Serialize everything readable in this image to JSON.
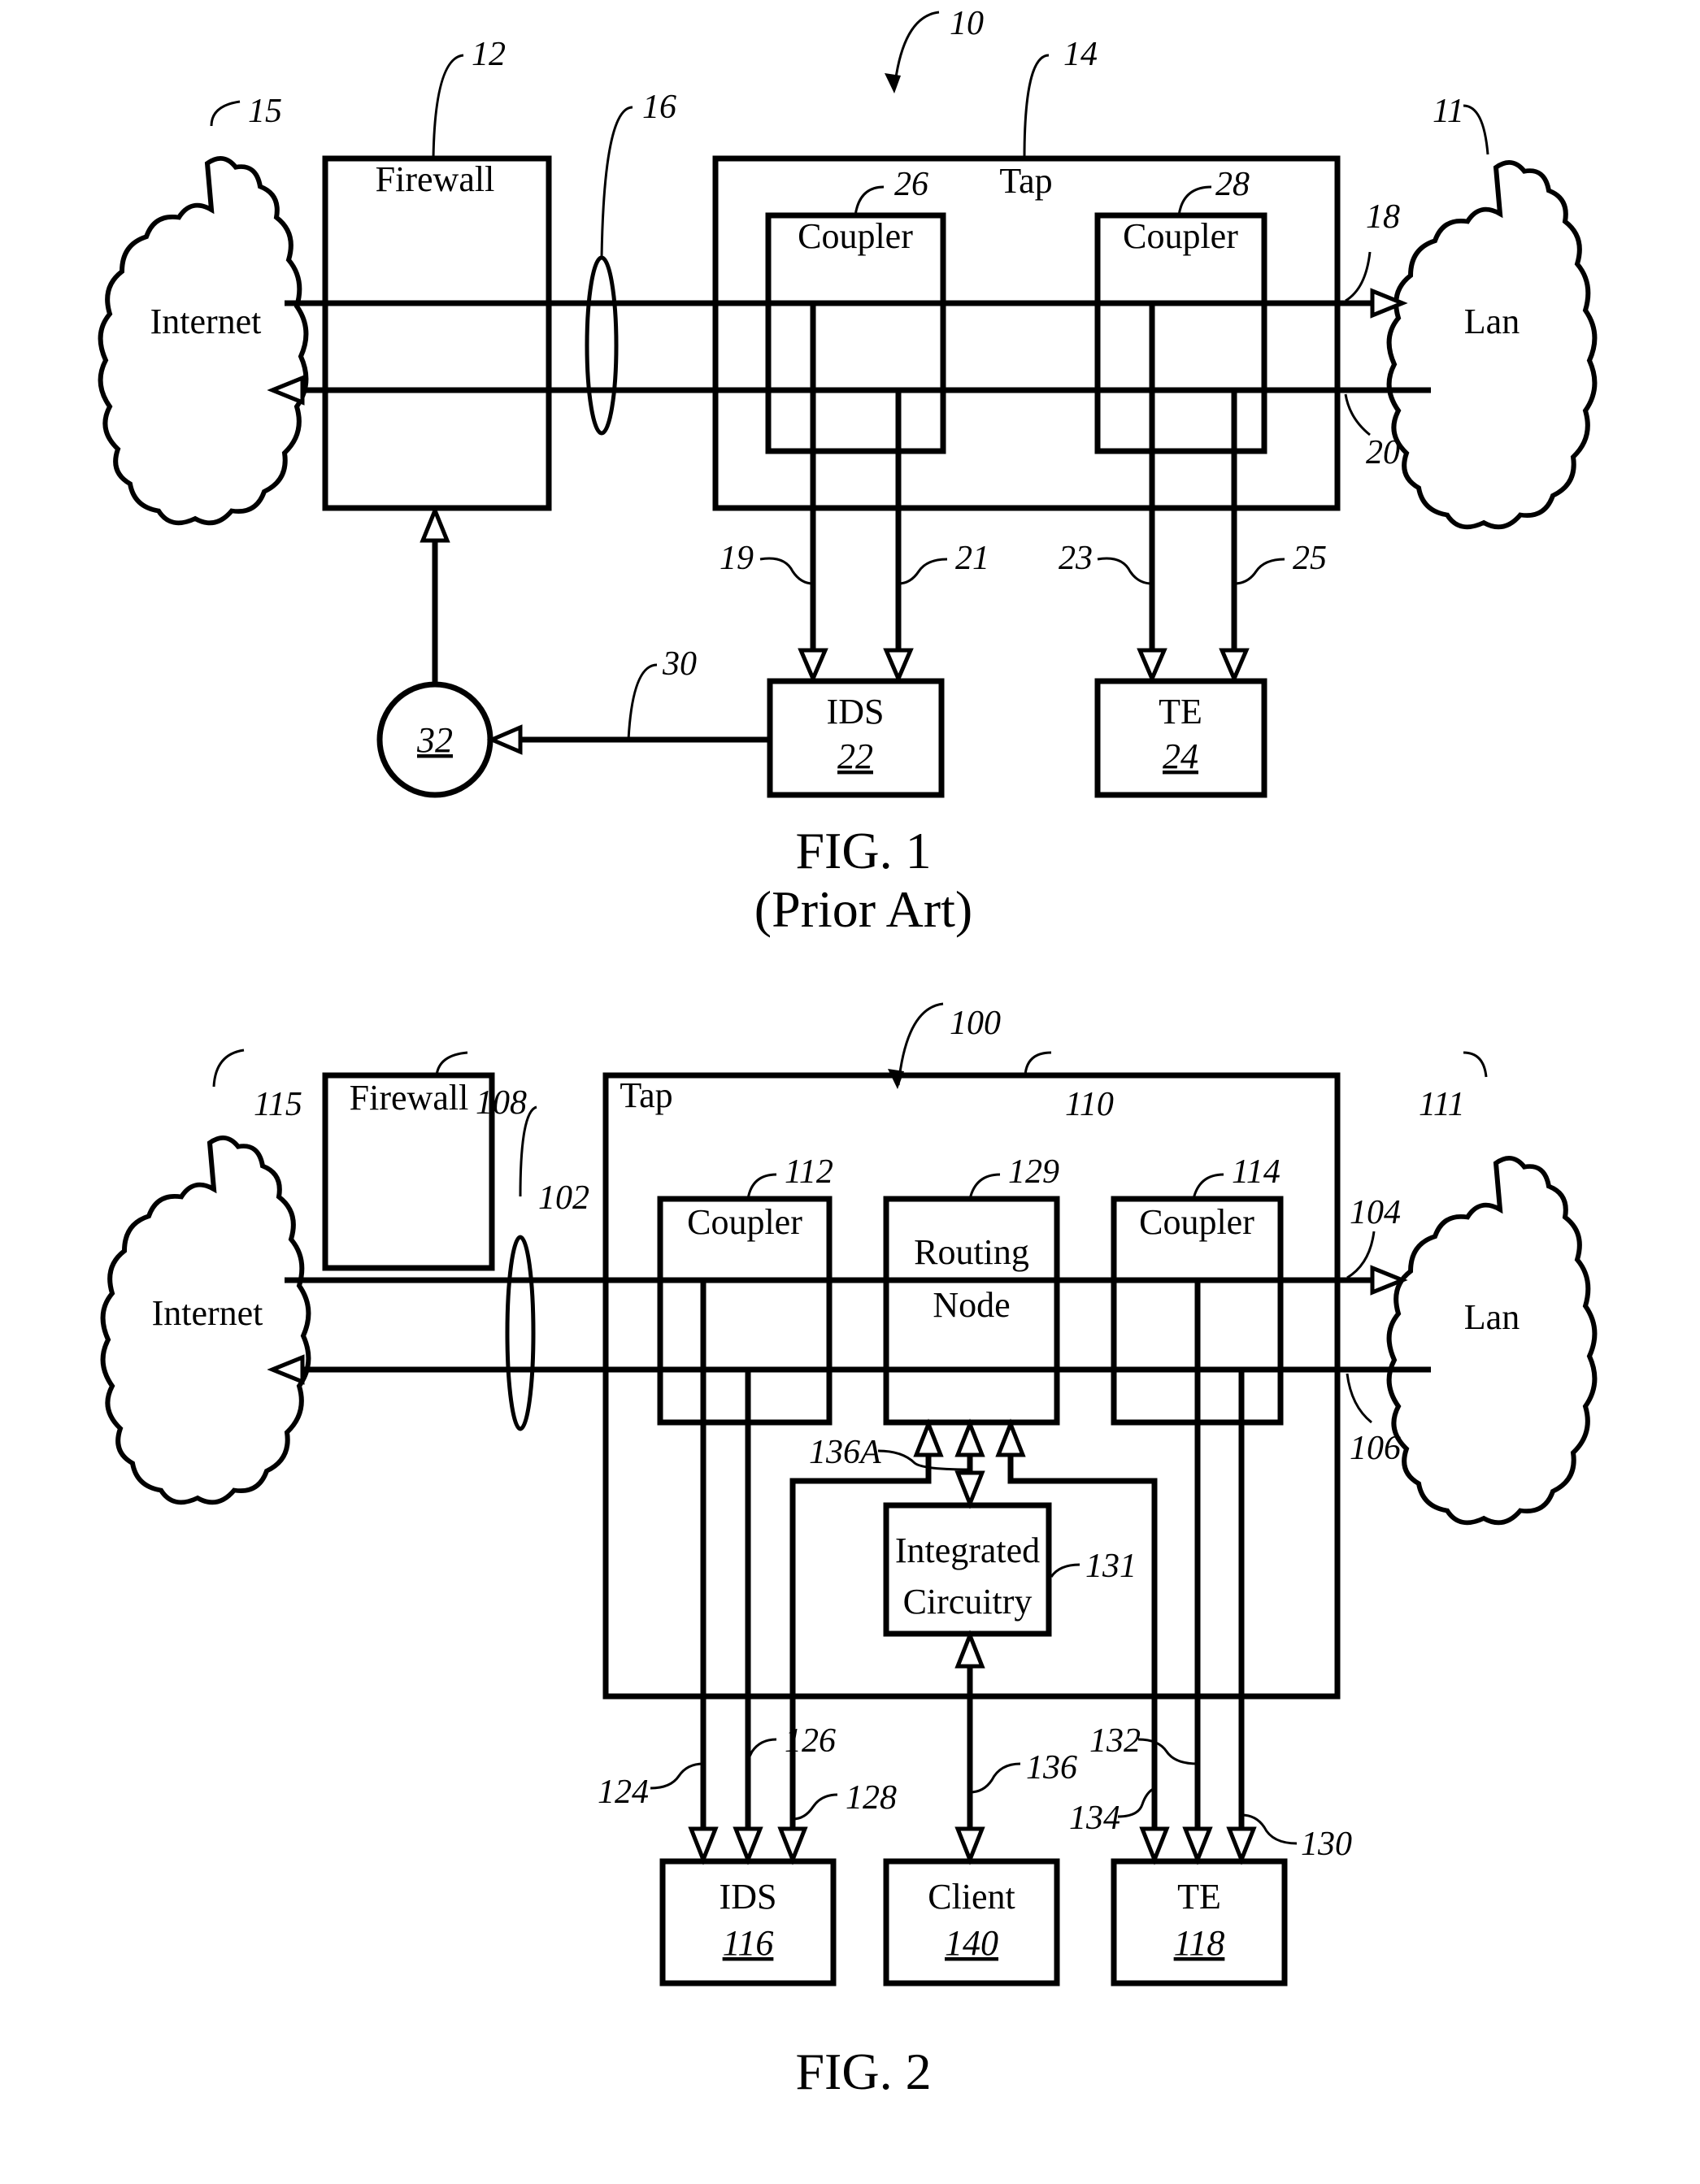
{
  "figures": [
    {
      "id": "fig1",
      "caption": "FIG. 1",
      "subcaption": "(Prior Art)",
      "system_ref": "10",
      "internet": {
        "label": "Internet",
        "ref": "15"
      },
      "lan": {
        "label": "Lan",
        "ref": "11"
      },
      "firewall": {
        "label": "Firewall",
        "ref": "12"
      },
      "link_bundle_ref": "16",
      "tap": {
        "label": "Tap",
        "ref": "14"
      },
      "coupler_left": {
        "label": "Coupler",
        "ref": "26"
      },
      "coupler_right": {
        "label": "Coupler",
        "ref": "28"
      },
      "line_top_ref": "18",
      "line_bottom_ref": "20",
      "ids": {
        "label": "IDS",
        "ref": "22"
      },
      "te": {
        "label": "TE",
        "ref": "24"
      },
      "feeds": [
        "19",
        "21",
        "23",
        "25"
      ],
      "alert_line_ref": "30",
      "controller": {
        "ref": "32"
      }
    },
    {
      "id": "fig2",
      "caption": "FIG. 2",
      "system_ref": "100",
      "internet": {
        "label": "Internet",
        "ref": "115"
      },
      "lan": {
        "label": "Lan",
        "ref": "111"
      },
      "firewall": {
        "label": "Firewall",
        "ref": "108"
      },
      "link_bundle_ref": "102",
      "tap": {
        "label": "Tap",
        "ref": "110"
      },
      "coupler_left": {
        "label": "Coupler",
        "ref": "112"
      },
      "routing_node": {
        "label_line1": "Routing",
        "label_line2": "Node",
        "ref": "129"
      },
      "coupler_right": {
        "label": "Coupler",
        "ref": "114"
      },
      "line_top_ref": "104",
      "line_bottom_ref": "106",
      "integrated_circuitry": {
        "label_line1": "Integrated",
        "label_line2": "Circuitry",
        "ref": "131"
      },
      "bus_ref": "136A",
      "ids": {
        "label": "IDS",
        "ref": "116"
      },
      "client": {
        "label": "Client",
        "ref": "140"
      },
      "te": {
        "label": "TE",
        "ref": "118"
      },
      "feeds": {
        "f124": "124",
        "f126": "126",
        "f128": "128",
        "f132": "132",
        "f134": "134",
        "f130": "130",
        "f136": "136"
      }
    }
  ]
}
